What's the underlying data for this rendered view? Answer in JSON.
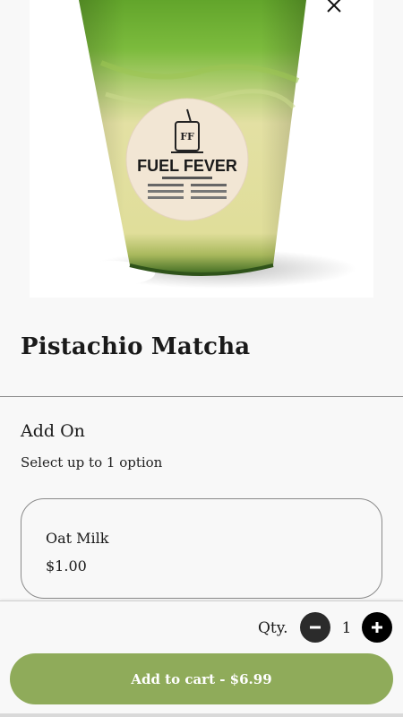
{
  "product": {
    "name": "Pistachio Matcha",
    "image_alt": "Pistachio Matcha drink",
    "logo_text": "FUEL FEVER"
  },
  "addon": {
    "title": "Add On",
    "subtitle": "Select up to 1 option",
    "options": [
      {
        "name": "Oat Milk",
        "price": "$1.00"
      }
    ]
  },
  "footer": {
    "qty_label": "Qty.",
    "qty_value": "1",
    "add_to_cart_label": "Add to cart - $6.99"
  },
  "icons": {
    "close": "close-icon",
    "minus": "minus-icon",
    "plus": "plus-icon"
  },
  "colors": {
    "accent": "#8fab5a",
    "matcha_green": "#6fae33",
    "milk": "#e8e5a6"
  }
}
